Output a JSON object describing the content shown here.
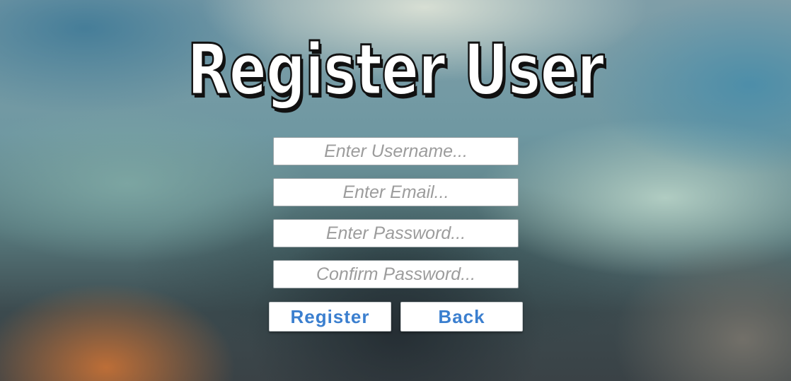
{
  "title": "Register User",
  "form": {
    "username_placeholder": "Enter Username...",
    "email_placeholder": "Enter Email...",
    "password_placeholder": "Enter Password...",
    "confirm_password_placeholder": "Confirm Password..."
  },
  "buttons": {
    "register_label": "Register",
    "back_label": "Back"
  },
  "colors": {
    "button_text": "#3b7fcf",
    "title_fill": "#ffffff",
    "title_outline": "#111111",
    "placeholder_text": "#9c9c9c"
  }
}
